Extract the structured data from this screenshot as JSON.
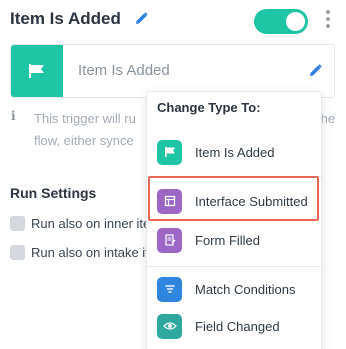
{
  "header": {
    "title": "Item Is Added",
    "toggle_on": true
  },
  "card": {
    "field_value": "Item Is Added"
  },
  "info": {
    "line1_start": "This trigger will ru",
    "line1_end": "the",
    "line2": "flow, either synce"
  },
  "run_settings": {
    "title": "Run Settings",
    "options": [
      {
        "label": "Run also on inner ite",
        "checked": false
      },
      {
        "label": "Run also on intake it",
        "checked": false
      }
    ]
  },
  "dropdown": {
    "heading": "Change Type To:",
    "items": [
      {
        "label": "Item Is Added",
        "icon": "flag-icon",
        "color": "#1ec5a5"
      },
      {
        "label": "Interface Submitted",
        "icon": "interface-icon",
        "color": "#9b66c4",
        "highlighted": true
      },
      {
        "label": "Form Filled",
        "icon": "form-icon",
        "color": "#9b66c4"
      },
      {
        "label": "Match Conditions",
        "icon": "filter-icon",
        "color": "#2f86de"
      },
      {
        "label": "Field Changed",
        "icon": "eye-icon",
        "color": "#2fa8a0"
      }
    ]
  },
  "colors": {
    "accent_teal": "#1ec5a5",
    "purple": "#9b66c4",
    "blue": "#2f86de",
    "highlight_border": "#e8695a",
    "pencil_blue": "#2f7fe0"
  }
}
